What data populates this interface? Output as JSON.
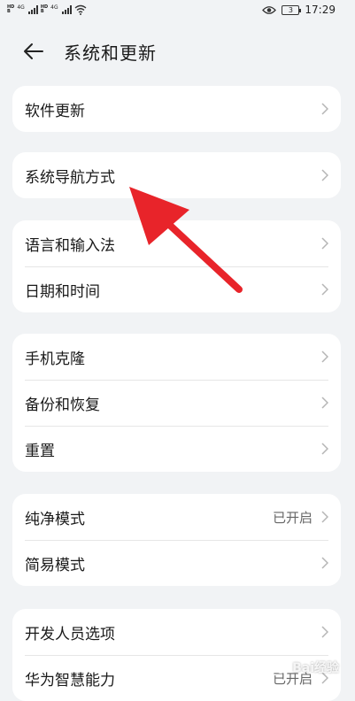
{
  "status_bar": {
    "sim1": [
      "HD",
      "B"
    ],
    "sim2": [
      "HD",
      "B"
    ],
    "net1": "4G",
    "net2": "4G",
    "battery": "3",
    "time": "17:29"
  },
  "header": {
    "title": "系统和更新"
  },
  "groups": [
    {
      "items": [
        {
          "label": "软件更新"
        }
      ]
    },
    {
      "items": [
        {
          "label": "系统导航方式"
        }
      ]
    },
    {
      "items": [
        {
          "label": "语言和输入法"
        },
        {
          "label": "日期和时间"
        }
      ]
    },
    {
      "items": [
        {
          "label": "手机克隆"
        },
        {
          "label": "备份和恢复"
        },
        {
          "label": "重置"
        }
      ]
    },
    {
      "items": [
        {
          "label": "纯净模式",
          "value": "已开启"
        },
        {
          "label": "简易模式"
        }
      ]
    },
    {
      "items": [
        {
          "label": "开发人员选项"
        },
        {
          "label": "华为智慧能力",
          "value": "已开启"
        }
      ]
    }
  ],
  "watermark": {
    "text": "Bai经验"
  },
  "colors": {
    "background": "#f1f3f5",
    "card": "#ffffff",
    "arrow": "#e8242a"
  }
}
